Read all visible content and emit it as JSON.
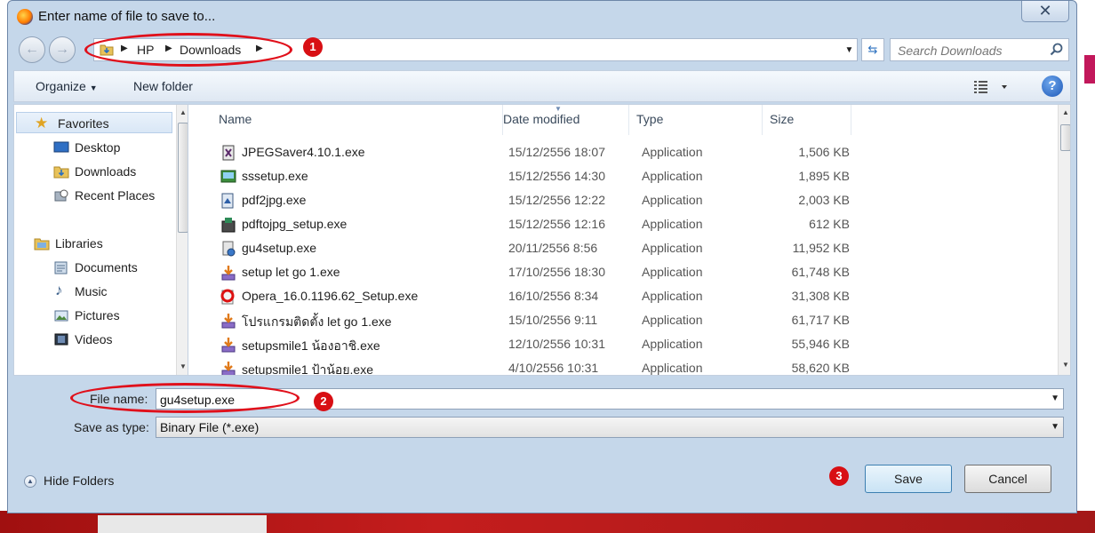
{
  "window": {
    "title": "Enter name of file to save to...",
    "close_label": "✕"
  },
  "address": {
    "breadcrumbs": [
      "HP",
      "Downloads"
    ],
    "search_placeholder": "Search Downloads"
  },
  "toolbar": {
    "organize_label": "Organize",
    "new_folder_label": "New folder"
  },
  "nav": {
    "favorites_header": "Favorites",
    "favorites": [
      "Desktop",
      "Downloads",
      "Recent Places"
    ],
    "libraries_header": "Libraries",
    "libraries": [
      "Documents",
      "Music",
      "Pictures",
      "Videos"
    ]
  },
  "columns": {
    "name": "Name",
    "date": "Date modified",
    "type": "Type",
    "size": "Size"
  },
  "files": [
    {
      "name": "JPEGSaver4.10.1.exe",
      "date": "15/12/2556 18:07",
      "type": "Application",
      "size": "1,506 KB"
    },
    {
      "name": "sssetup.exe",
      "date": "15/12/2556 14:30",
      "type": "Application",
      "size": "1,895 KB"
    },
    {
      "name": "pdf2jpg.exe",
      "date": "15/12/2556 12:22",
      "type": "Application",
      "size": "2,003 KB"
    },
    {
      "name": "pdftojpg_setup.exe",
      "date": "15/12/2556 12:16",
      "type": "Application",
      "size": "612 KB"
    },
    {
      "name": "gu4setup.exe",
      "date": "20/11/2556 8:56",
      "type": "Application",
      "size": "11,952 KB"
    },
    {
      "name": "setup let go 1.exe",
      "date": "17/10/2556 18:30",
      "type": "Application",
      "size": "61,748 KB"
    },
    {
      "name": "Opera_16.0.1196.62_Setup.exe",
      "date": "16/10/2556 8:34",
      "type": "Application",
      "size": "31,308 KB"
    },
    {
      "name": "โปรแกรมติดตั้ง let go 1.exe",
      "date": "15/10/2556 9:11",
      "type": "Application",
      "size": "61,717 KB"
    },
    {
      "name": "setupsmile1 น้องอาชิ.exe",
      "date": "12/10/2556 10:31",
      "type": "Application",
      "size": "55,946 KB"
    },
    {
      "name": "setupsmile1 ป้าน้อย.exe",
      "date": "4/10/2556 10:31",
      "type": "Application",
      "size": "58,620 KB"
    }
  ],
  "form": {
    "file_name_label": "File name:",
    "file_name_value": "gu4setup.exe",
    "save_type_label": "Save as type:",
    "save_type_value": "Binary File (*.exe)"
  },
  "footer": {
    "hide_folders_label": "Hide Folders",
    "save_label": "Save",
    "cancel_label": "Cancel"
  },
  "annotations": [
    "1",
    "2",
    "3"
  ],
  "colors": {
    "annotation_red": "#e0101b",
    "dialog_bg": "#c5d7ea",
    "accent_blue": "#1c58b8"
  }
}
